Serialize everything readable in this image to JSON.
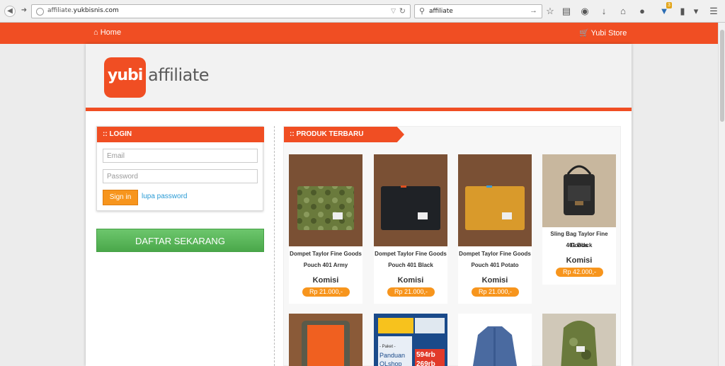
{
  "browser": {
    "url_domain": "affiliate.",
    "url_rest": "yukbisnis.com",
    "search_query": "affiliate",
    "badge_count": "3"
  },
  "nav": {
    "home_label": "Home",
    "store_label": "Yubi Store"
  },
  "logo": {
    "badge_text": "yubi",
    "word": "affiliate"
  },
  "login": {
    "title": ":: LOGIN",
    "email_placeholder": "Email",
    "password_placeholder": "Password",
    "signin_label": "Sign in",
    "forgot_label": "lupa password",
    "register_label": "DAFTAR SEKARANG"
  },
  "products": {
    "title": ":: PRODUK TERBARU",
    "items": [
      {
        "name_1": "Dompet Taylor Fine Goods",
        "name_2": "Pouch 401 Army",
        "komisi": "Komisi",
        "price": "Rp 21.000,-",
        "color": "#6a7a3c"
      },
      {
        "name_1": "Dompet Taylor Fine Goods",
        "name_2": "Pouch 401 Black",
        "komisi": "Komisi",
        "price": "Rp 21.000,-",
        "color": "#1f2226"
      },
      {
        "name_1": "Dompet Taylor Fine Goods",
        "name_2": "Pouch 401 Potato",
        "komisi": "Komisi",
        "price": "Rp 21.000,-",
        "color": "#d99a2b"
      },
      {
        "name_1": "Sling Bag Taylor Fine Goods",
        "name_2": "401 Black",
        "komisi": "Komisi",
        "price": "Rp 42.000,-",
        "color": "#2a2a2a"
      }
    ],
    "row2_labels": {
      "panduan": "Panduan",
      "olshop": "OLshop",
      "price_a": "594rb",
      "price_b": "269rb",
      "paket": "- Paket -"
    }
  },
  "colors": {
    "brand": "#f04e23",
    "accent": "#f7951d",
    "green": "#5cb85c",
    "link": "#2a9bd5"
  }
}
